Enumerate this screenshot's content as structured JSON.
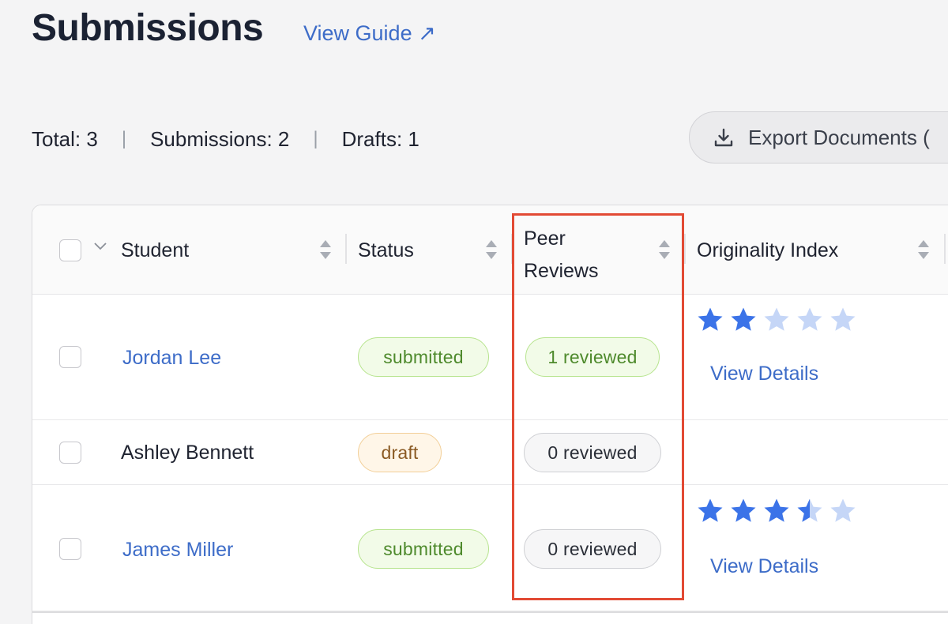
{
  "header": {
    "title": "Submissions",
    "guide_link": "View Guide ↗"
  },
  "summary": {
    "total": "Total: 3",
    "submissions": "Submissions: 2",
    "drafts": "Drafts: 1",
    "separator": "|"
  },
  "toolbar": {
    "export_label": "Export Documents (",
    "export_icon": "download-icon"
  },
  "table": {
    "columns": [
      {
        "label": "Student"
      },
      {
        "label": "Status"
      },
      {
        "label_line1": "Peer",
        "label_line2": "Reviews"
      },
      {
        "label": "Originality Index"
      }
    ],
    "rows": [
      {
        "student": "Jordan Lee",
        "student_is_link": true,
        "status": "submitted",
        "peer_reviews": "1 reviewed",
        "originality_stars": 2,
        "details": "View Details"
      },
      {
        "student": "Ashley Bennett",
        "student_is_link": false,
        "status": "draft",
        "peer_reviews": "0 reviewed",
        "originality_stars": null,
        "details": ""
      },
      {
        "student": "James Miller",
        "student_is_link": true,
        "status": "submitted",
        "peer_reviews": "0 reviewed",
        "originality_stars": 3.5,
        "details": "View Details"
      }
    ],
    "max_stars": 5
  },
  "colors": {
    "accent": "#3d6cc8",
    "star_filled": "#3b73e8",
    "star_empty": "#c5d6f7",
    "highlight": "#e24a34"
  }
}
